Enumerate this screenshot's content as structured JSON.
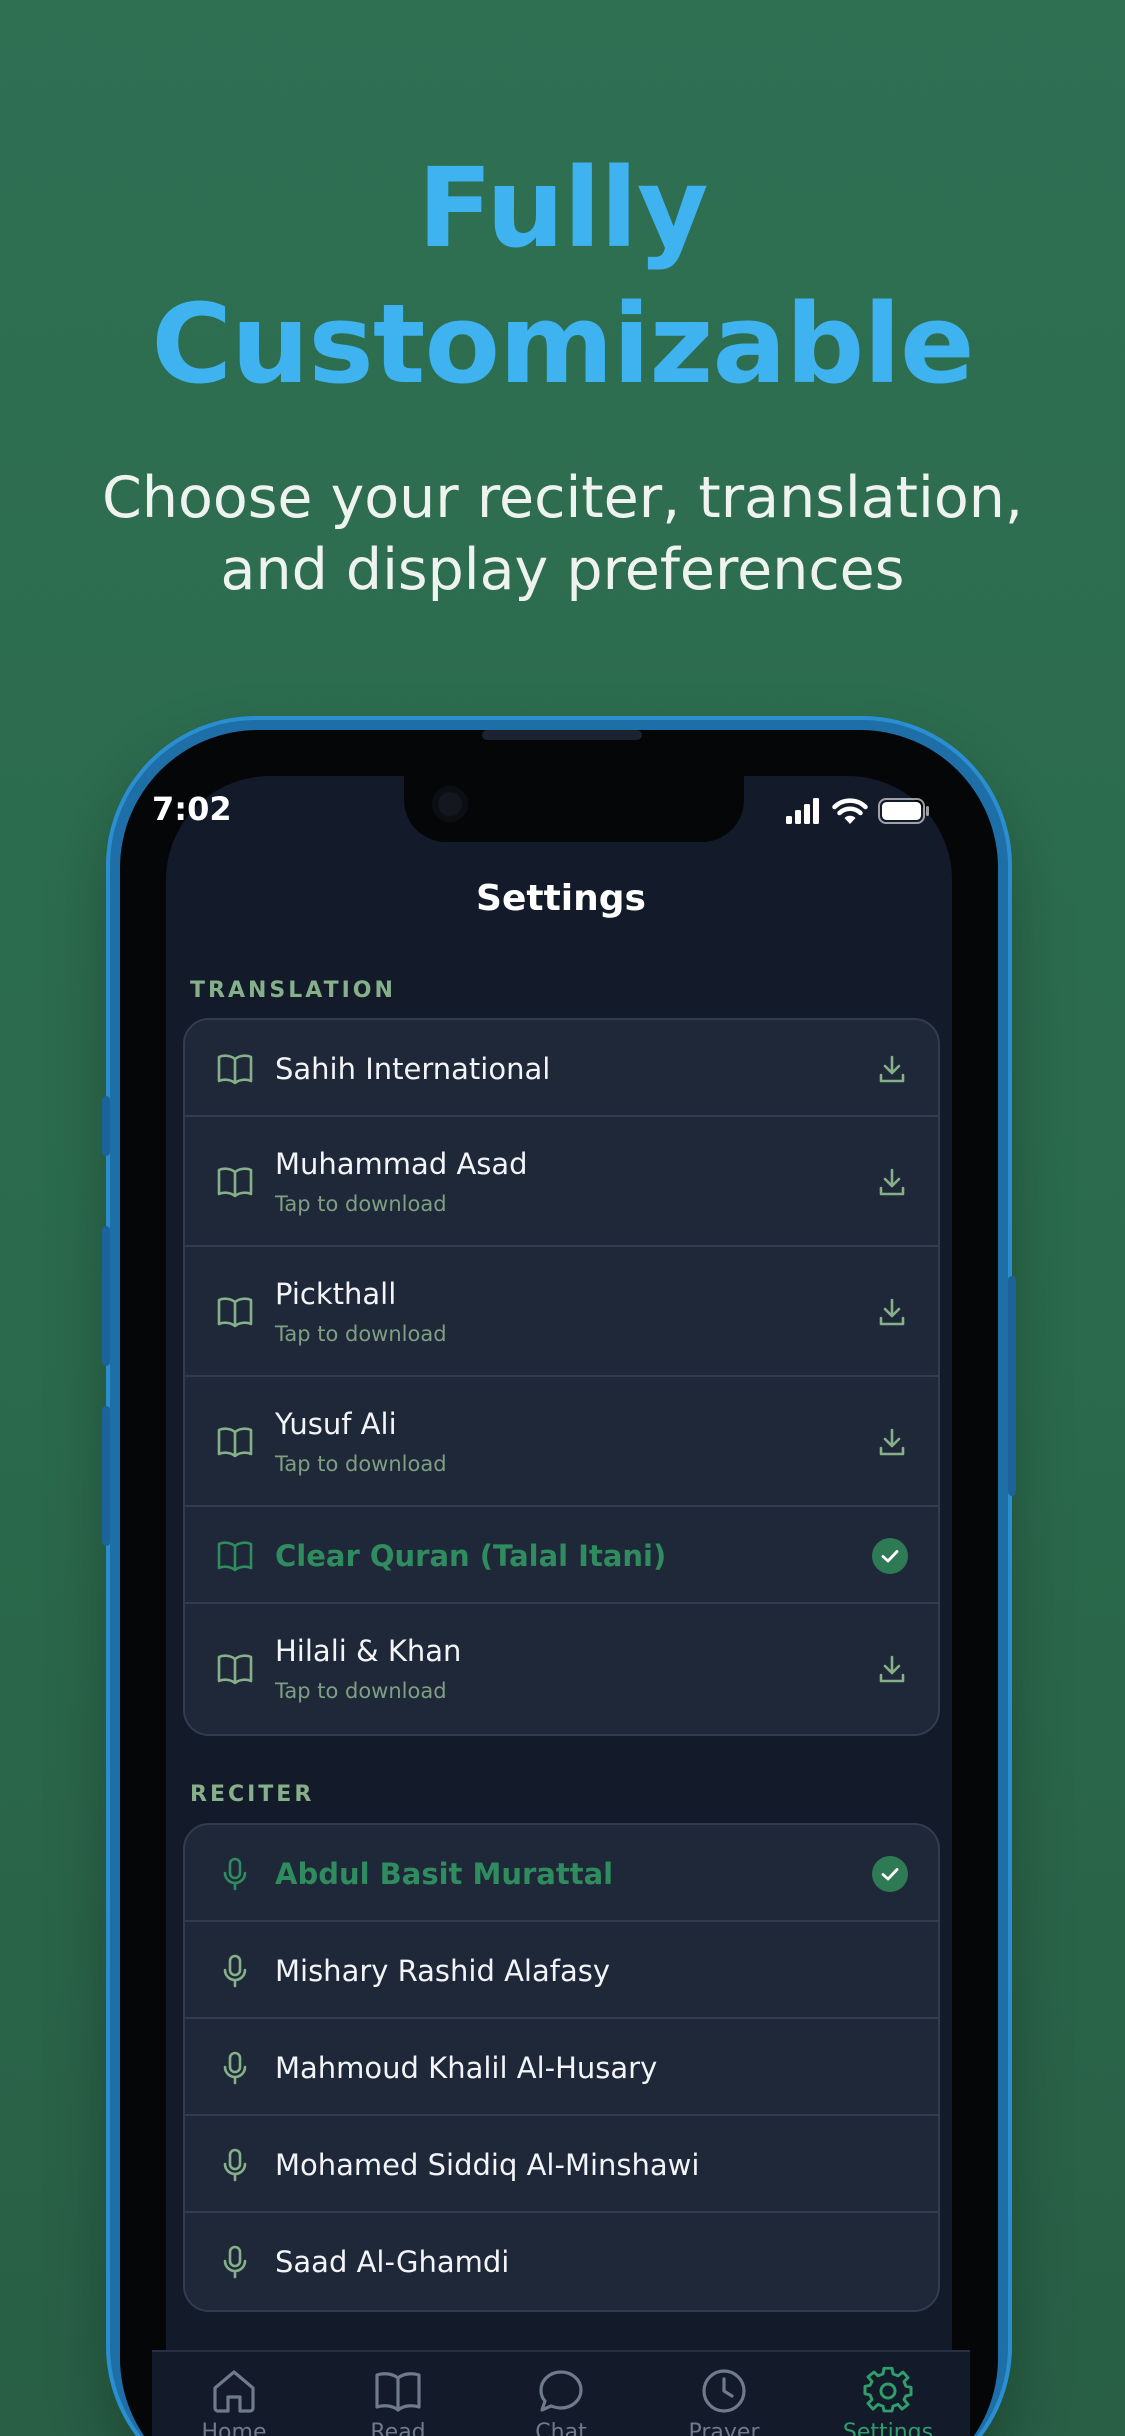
{
  "headline": {
    "line1": "Fully",
    "line2": "Customizable"
  },
  "subheadline": {
    "line1": "Choose your reciter, translation,",
    "line2": "and display preferences"
  },
  "status_bar": {
    "time": "7:02"
  },
  "screen_title": "Settings",
  "translation_section": {
    "label": "TRANSLATION",
    "items": [
      {
        "title": "Sahih International",
        "subtitle": "",
        "state": "download"
      },
      {
        "title": "Muhammad Asad",
        "subtitle": "Tap to download",
        "state": "download"
      },
      {
        "title": "Pickthall",
        "subtitle": "Tap to download",
        "state": "download"
      },
      {
        "title": "Yusuf Ali",
        "subtitle": "Tap to download",
        "state": "download"
      },
      {
        "title": "Clear Quran (Talal Itani)",
        "subtitle": "",
        "state": "selected"
      },
      {
        "title": "Hilali & Khan",
        "subtitle": "Tap to download",
        "state": "download"
      }
    ]
  },
  "reciter_section": {
    "label": "RECITER",
    "items": [
      {
        "title": "Abdul Basit Murattal",
        "state": "selected"
      },
      {
        "title": "Mishary Rashid Alafasy",
        "state": "none"
      },
      {
        "title": "Mahmoud Khalil Al-Husary",
        "state": "none"
      },
      {
        "title": "Mohamed Siddiq Al-Minshawi",
        "state": "none"
      },
      {
        "title": "Saad Al-Ghamdi",
        "state": "none"
      }
    ]
  },
  "tab_bar": {
    "tabs": [
      {
        "label": "Home",
        "icon": "home-icon"
      },
      {
        "label": "Read",
        "icon": "book-icon"
      },
      {
        "label": "Chat",
        "icon": "chat-icon"
      },
      {
        "label": "Prayer",
        "icon": "clock-icon"
      },
      {
        "label": "Settings",
        "icon": "gear-icon",
        "active": true
      }
    ]
  },
  "colors": {
    "background": "#2e6b4f",
    "headline": "#3fb2f0",
    "accent_green": "#2f8c5e",
    "screen_bg": "#131a2a",
    "card_bg": "#1f2838"
  }
}
